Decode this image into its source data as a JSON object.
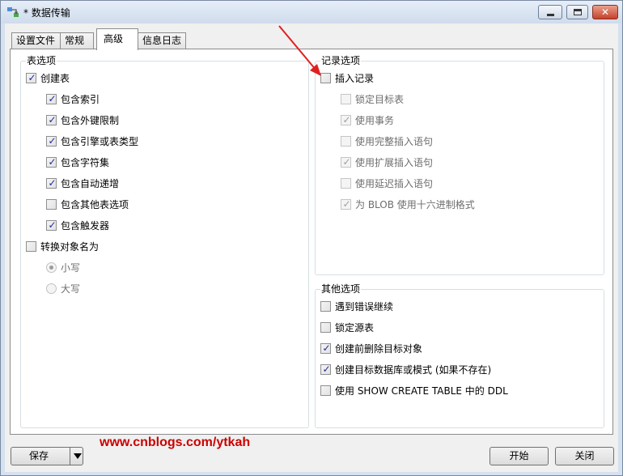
{
  "window": {
    "title": "* 数据传输",
    "minimize_glyph": "",
    "close_glyph": "✕"
  },
  "tabs": [
    "设置文件",
    "常规",
    "高级",
    "信息日志"
  ],
  "active_tab": "高级",
  "table_options": {
    "title": "表选项",
    "create_table": {
      "label": "创建表",
      "checked": true
    },
    "sub_options": [
      {
        "label": "包含索引",
        "checked": true
      },
      {
        "label": "包含外键限制",
        "checked": true
      },
      {
        "label": "包含引擎或表类型",
        "checked": true
      },
      {
        "label": "包含字符集",
        "checked": true
      },
      {
        "label": "包含自动递增",
        "checked": true
      },
      {
        "label": "包含其他表选项",
        "checked": false
      },
      {
        "label": "包含触发器",
        "checked": true
      }
    ],
    "convert_names": {
      "label": "转换对象名为",
      "checked": false
    },
    "case_options": [
      {
        "label": "小写",
        "selected": true
      },
      {
        "label": "大写",
        "selected": false
      }
    ]
  },
  "record_options": {
    "title": "记录选项",
    "insert_records": {
      "label": "插入记录",
      "checked": false
    },
    "sub_options": [
      {
        "label": "锁定目标表",
        "checked": false
      },
      {
        "label": "使用事务",
        "checked": true
      },
      {
        "label": "使用完整插入语句",
        "checked": false
      },
      {
        "label": "使用扩展插入语句",
        "checked": true
      },
      {
        "label": "使用延迟插入语句",
        "checked": false
      },
      {
        "label": "为 BLOB 使用十六进制格式",
        "checked": true
      }
    ]
  },
  "other_options": {
    "title": "其他选项",
    "items": [
      {
        "label": "遇到错误继续",
        "checked": false
      },
      {
        "label": "锁定源表",
        "checked": false
      },
      {
        "label": "创建前删除目标对象",
        "checked": true
      },
      {
        "label": "创建目标数据库或模式 (如果不存在)",
        "checked": true
      },
      {
        "label": "使用 SHOW CREATE TABLE 中的 DDL",
        "checked": false
      }
    ]
  },
  "watermark": "www.cnblogs.com/ytkah",
  "buttons": {
    "save": "保存",
    "start": "开始",
    "close": "关闭"
  },
  "colors": {
    "annotation_arrow": "#e02020",
    "watermark": "#cc0000",
    "check_tick": "#21299a"
  }
}
